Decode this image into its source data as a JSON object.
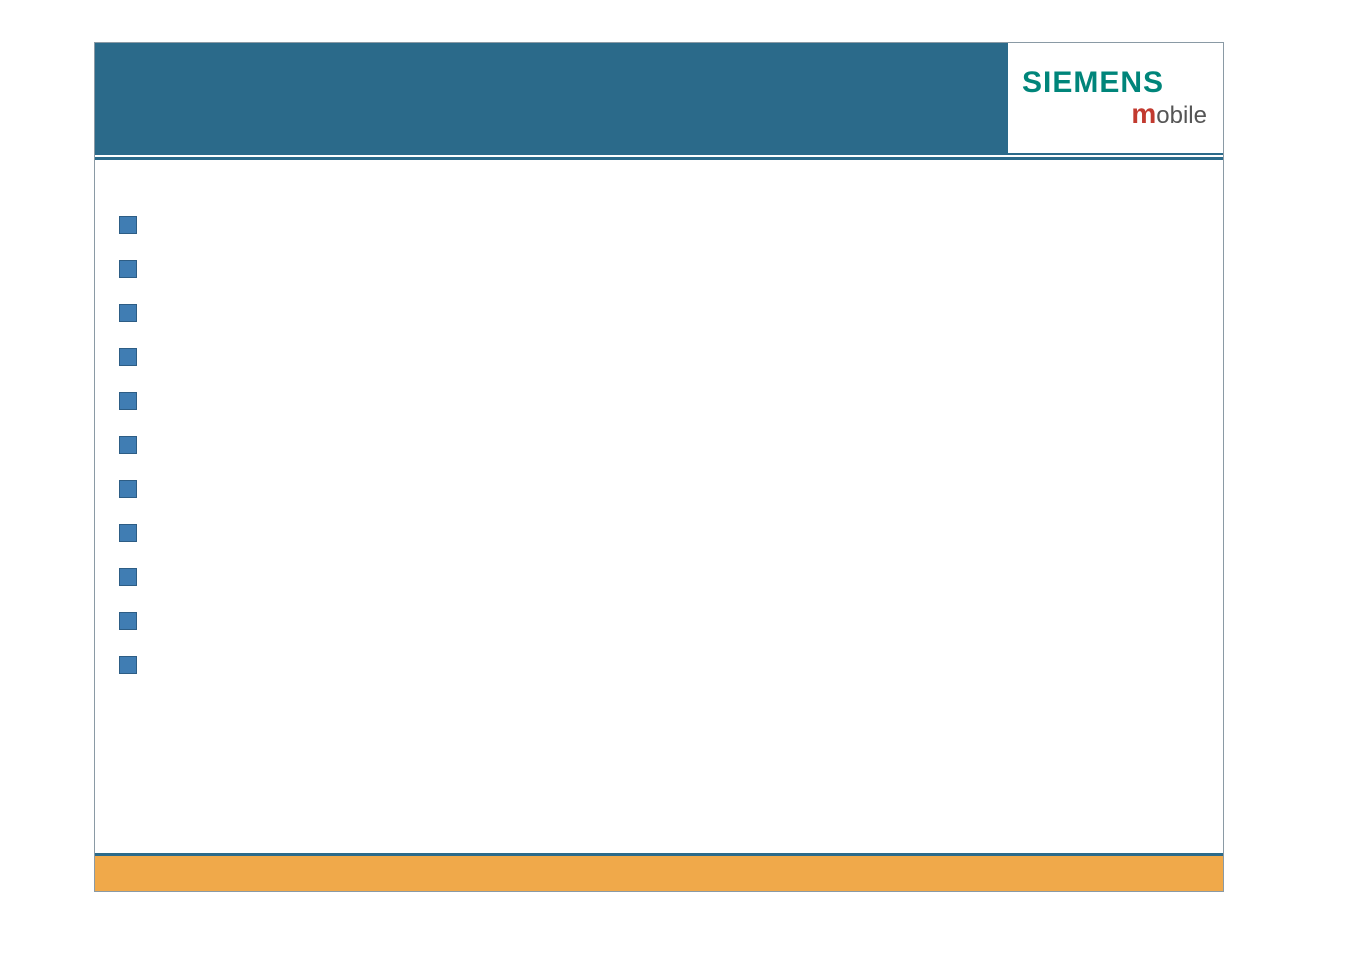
{
  "logo": {
    "brand": "SIEMENS",
    "sub_m": "m",
    "sub_rest": "obile"
  },
  "bullets": [
    {
      "text": ""
    },
    {
      "text": ""
    },
    {
      "text": ""
    },
    {
      "text": ""
    },
    {
      "text": ""
    },
    {
      "text": ""
    },
    {
      "text": ""
    },
    {
      "text": ""
    },
    {
      "text": ""
    },
    {
      "text": ""
    },
    {
      "text": ""
    }
  ]
}
